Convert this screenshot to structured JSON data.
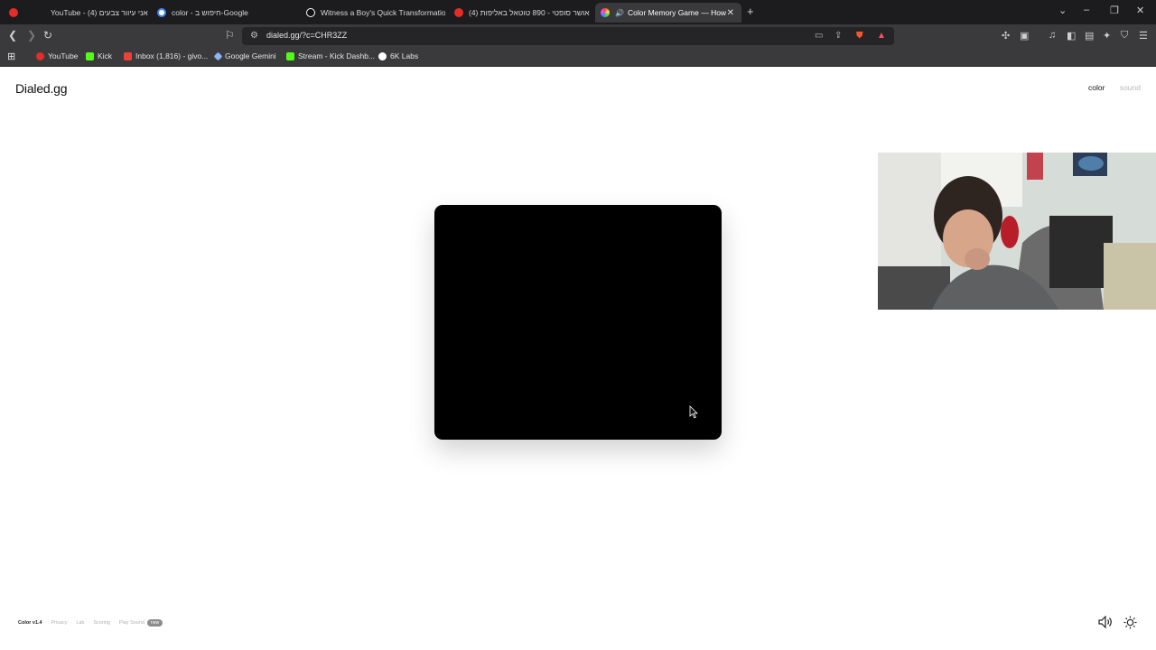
{
  "browser": {
    "tabs": [
      {
        "title": "YouTube - אני עיוור צבעים (4)",
        "favicon_color": "#e52d27",
        "active": false
      },
      {
        "title": "color - חיפוש ב-Google",
        "favicon_color": "#ffffff",
        "active": false
      },
      {
        "title": "Witness a Boy's Quick Transformatio",
        "favicon_color": "#111111",
        "active": false
      },
      {
        "title": "(4) אושר סופטי - 890 טוטאל באליפות",
        "favicon_color": "#e52d27",
        "active": false
      },
      {
        "title": "Color Memory Game — How",
        "favicon_color": "#f4a742",
        "active": true
      }
    ],
    "new_tab": "+",
    "url": "dialed.gg/?c=CHR3ZZ",
    "bookmarks": [
      {
        "label": "YouTube",
        "color": "#e52d27"
      },
      {
        "label": "Kick",
        "color": "#53fc18"
      },
      {
        "label": "Inbox (1,816) - givo...",
        "color": "#ea4335"
      },
      {
        "label": "Google Gemini",
        "color": "#8ab4f8"
      },
      {
        "label": "Stream - Kick Dashb...",
        "color": "#53fc18"
      },
      {
        "label": "6K Labs",
        "color": "#ffffff"
      }
    ]
  },
  "page": {
    "logo": "Dialed.gg",
    "modes": {
      "color": "color",
      "sound": "sound"
    },
    "swatch_color": "#000000",
    "footer": {
      "version": "Color v1.4",
      "links": [
        "Privacy",
        "Lab",
        "Scoring",
        "Play Sound"
      ],
      "badge": "new"
    }
  }
}
